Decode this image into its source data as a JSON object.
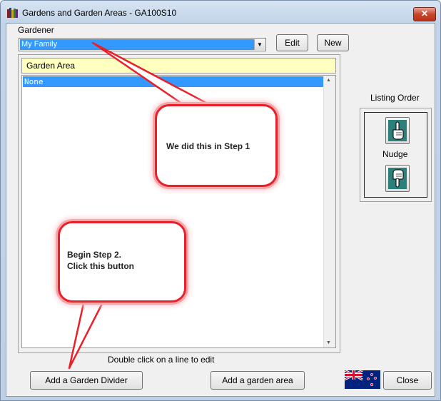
{
  "window": {
    "title": "Gardens and Garden Areas - GA100S10",
    "close_glyph": "✕"
  },
  "gardener": {
    "label": "Gardener",
    "selected": "My Family",
    "dropdown_glyph": "▼"
  },
  "buttons": {
    "edit": "Edit",
    "new": "New",
    "add_divider": "Add a Garden Divider",
    "add_area": "Add a garden area",
    "close": "Close"
  },
  "list": {
    "header": "Garden Area",
    "rows": [
      "None"
    ],
    "hint": "Double click on  a line to edit"
  },
  "listing_order": {
    "label": "Listing Order",
    "nudge_label": "Nudge"
  },
  "callouts": {
    "step1": "We did this in Step 1",
    "step2_line1": "Begin Step 2.",
    "step2_line2": "Click this button"
  },
  "icons": {
    "app": "book-stack-icon",
    "nudge_up": "hand-pointing-up-icon",
    "nudge_down": "hand-pointing-down-icon",
    "flag": "new-zealand-flag-icon"
  },
  "colors": {
    "selection": "#3399ff",
    "header_bg": "#ffffc0",
    "callout_border": "#e8202a",
    "hand_tile": "#2d7f7a"
  }
}
